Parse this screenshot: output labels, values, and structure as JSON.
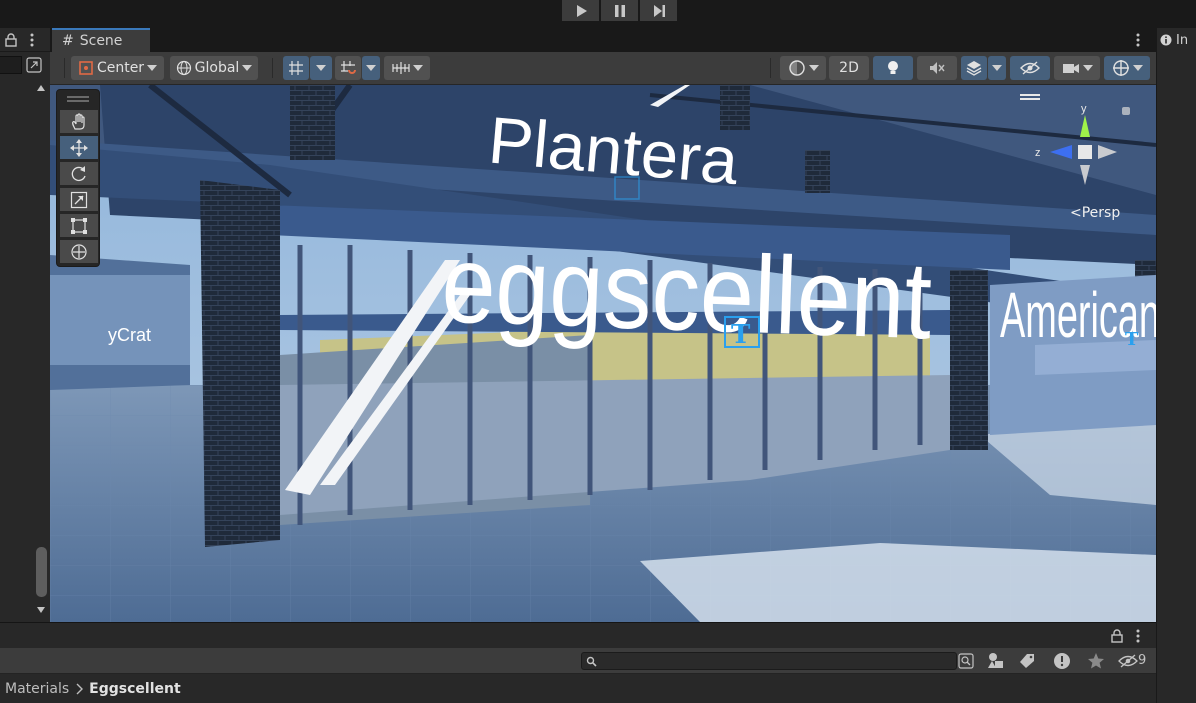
{
  "toolbar_top": {
    "play_icon": "play-icon",
    "pause_icon": "pause-icon",
    "step_icon": "step-icon"
  },
  "scene_window": {
    "tab_label": "Scene",
    "toolbar": {
      "pivot_label": "Center",
      "space_label": "Global",
      "mode_2d_label": "2D"
    },
    "camera_mode_label": "Persp",
    "gizmo_axes": [
      "y",
      "z"
    ]
  },
  "viewport": {
    "signs": {
      "main": "eggscellent",
      "top": "Plantera",
      "right": "American",
      "left": "yCrat"
    }
  },
  "inspector": {
    "tab_label": "In"
  },
  "project": {
    "hidden_count": "9",
    "search_placeholder": "",
    "breadcrumb": [
      "Materials",
      "Eggscellent"
    ]
  },
  "colors": {
    "accent": "#3a79bb",
    "active_button": "#46607c",
    "panel": "#3c3c3c",
    "dark_panel": "#282828"
  }
}
